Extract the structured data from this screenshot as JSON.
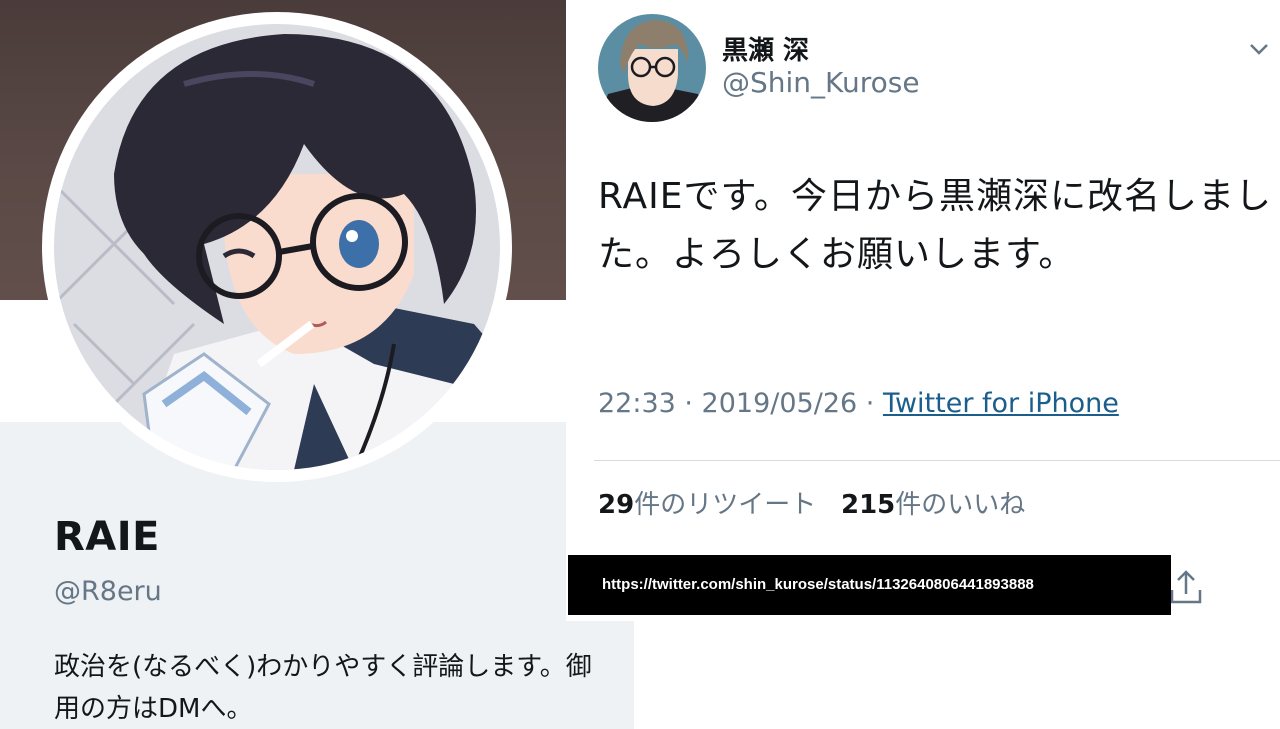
{
  "profile": {
    "display_name": "RAIE",
    "handle": "@R8eru",
    "bio": "政治を(なるべく)わかりやすく評論します。御用の方はDMへ。"
  },
  "tweet": {
    "author_name": "黒瀬 深",
    "author_handle": "@Shin_Kurose",
    "text": "RAIEです。今日から黒瀬深に改名しました。よろしくお願いします。",
    "time": "22:33 · 2019/05/26 · ",
    "client": "Twitter for iPhone",
    "retweet_count": "29",
    "retweet_label": "件のリツイート",
    "like_count": "215",
    "like_label": "件のいいね"
  },
  "url_overlay": "https://twitter.com/shin_kurose/status/1132640806441893888",
  "icons": {
    "caret": "chevron-down-icon",
    "share": "share-icon"
  },
  "colors": {
    "text": "#14171a",
    "secondary": "#657786",
    "link": "#1b5e8c",
    "profile_bg": "#eff2f4"
  }
}
